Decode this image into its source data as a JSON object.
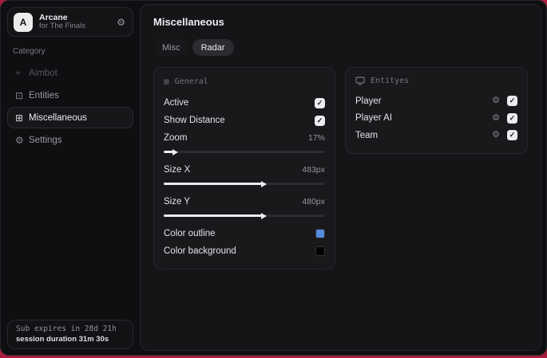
{
  "app": {
    "name": "Arcane",
    "subtitle": "for The Finals",
    "avatar_letter": "A"
  },
  "icons": {
    "gear": "⚙",
    "crosshair": "⌖",
    "entities_glyph": "⊡",
    "misc_glyph": "⊞",
    "general_glyph": "⊞",
    "check": "✓"
  },
  "sidebar": {
    "category_label": "Category",
    "items": [
      {
        "label": "Aimbot",
        "state": "disabled"
      },
      {
        "label": "Entities",
        "state": "normal"
      },
      {
        "label": "Miscellaneous",
        "state": "active",
        "watermark": "·······"
      },
      {
        "label": "Settings",
        "state": "normal"
      }
    ],
    "subscription": {
      "expires_text": "Sub expires in 28d 21h",
      "session_text": "session duration 31m 30s"
    }
  },
  "main": {
    "title": "Miscellaneous",
    "tabs": [
      {
        "label": "Misc",
        "active": false
      },
      {
        "label": "Radar",
        "active": true
      }
    ],
    "general": {
      "title": "General",
      "active": {
        "label": "Active",
        "checked": true
      },
      "show_distance": {
        "label": "Show Distance",
        "checked": true
      },
      "zoom": {
        "label": "Zoom",
        "value": "17%",
        "fill_percent": 6
      },
      "size_x": {
        "label": "Size X",
        "value": "483px",
        "fill_percent": 61
      },
      "size_y": {
        "label": "Size Y",
        "value": "480px",
        "fill_percent": 61
      },
      "color_outline": {
        "label": "Color outline",
        "color": "#568ae0"
      },
      "color_background": {
        "label": "Color background",
        "color": "#000000"
      }
    },
    "entities": {
      "title": "Entityes",
      "rows": [
        {
          "label": "Player",
          "checked": true
        },
        {
          "label": "Player AI",
          "checked": true
        },
        {
          "label": "Team",
          "checked": true
        }
      ]
    }
  },
  "colors": {
    "accent_blue": "#568ae0",
    "desktop_crimson": "#a81e3e",
    "panel_bg": "#151518",
    "card_bg": "#19191c"
  }
}
